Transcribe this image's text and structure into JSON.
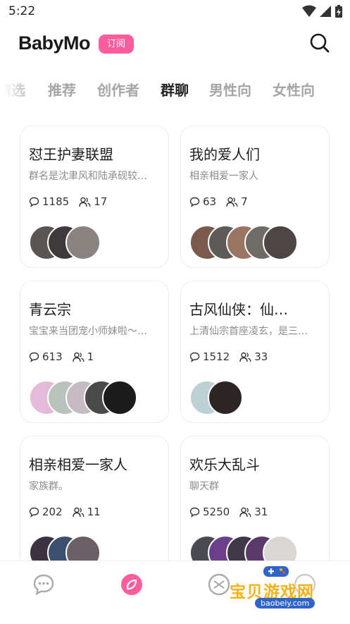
{
  "status_bar": {
    "time": "5:22"
  },
  "header": {
    "logo": "BabyMo",
    "subscribe_label": "订阅"
  },
  "tabs": [
    {
      "label": "精选"
    },
    {
      "label": "推荐"
    },
    {
      "label": "创作者"
    },
    {
      "label": "群聊"
    },
    {
      "label": "男性向"
    },
    {
      "label": "女性向"
    }
  ],
  "active_tab": "群聊",
  "cards": [
    {
      "title": "怼王护妻联盟",
      "desc": "群名是沈聿风和陆承砚较…",
      "comments": "1185",
      "members": "17",
      "avatar_colors": [
        "#5a5452",
        "#3e3a3b",
        "#8a8380"
      ]
    },
    {
      "title": "我的爱人们",
      "desc": "相亲相爱一家人",
      "comments": "63",
      "members": "7",
      "avatar_colors": [
        "#7a5a4c",
        "#5d5a57",
        "#9b7563",
        "#6f6b66",
        "#4e4545"
      ]
    },
    {
      "title": "青云宗",
      "desc": "宝宝来当团宠小师妹啦～…",
      "comments": "613",
      "members": "1",
      "avatar_colors": [
        "#e6b9d8",
        "#b8c3bd",
        "#c7bbc2",
        "#4a4a4a",
        "#1c1c1c"
      ]
    },
    {
      "title": "古风仙侠：仙…",
      "desc": "上清仙宗首座凌玄，是三…",
      "comments": "1512",
      "members": "33",
      "avatar_colors": [
        "#bcd0d6",
        "#2b2624"
      ]
    },
    {
      "title": "相亲相爱一家人",
      "desc": "家族群。",
      "comments": "202",
      "members": "11",
      "avatar_colors": [
        "#3b3440",
        "#3d4f6e",
        "#6b6065"
      ]
    },
    {
      "title": "欢乐大乱斗",
      "desc": "聊天群",
      "comments": "5250",
      "members": "31",
      "avatar_colors": [
        "#4a4a52",
        "#6b3f8a",
        "#3f3a4a",
        "#5a3a6a",
        "#d9d6d4"
      ]
    }
  ],
  "watermark": {
    "title": "宝贝游戏网",
    "url": "baobeiy.com"
  },
  "colors": {
    "accent": "#ff5c9e",
    "inactive_tab": "#a6a6a6"
  }
}
